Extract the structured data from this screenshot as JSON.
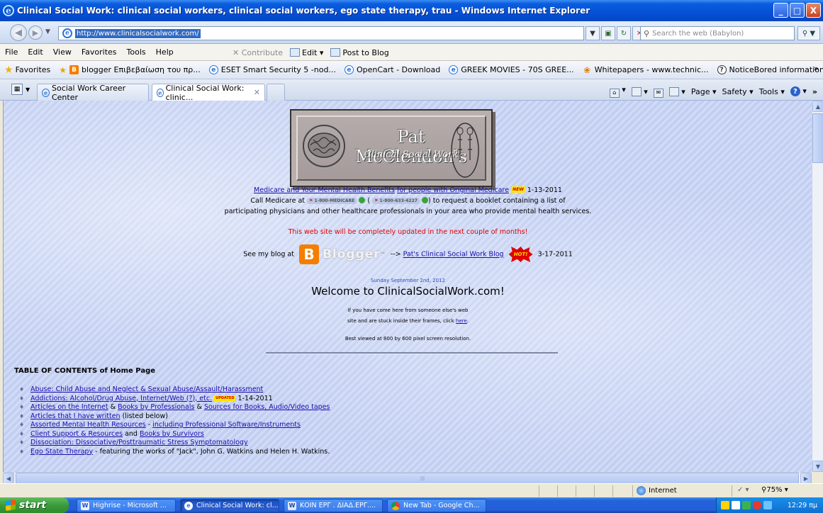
{
  "window": {
    "title": "Clinical Social Work: clinical social workers, clinical social workers, ego state therapy, trau - Windows Internet Explorer",
    "minimize": "_",
    "maximize": "□",
    "close": "X"
  },
  "address_bar": {
    "url": "http://www.clinicalsocialwork.com/",
    "search_placeholder": "Search the web (Babylon)"
  },
  "menu": {
    "items": [
      "File",
      "Edit",
      "View",
      "Favorites",
      "Tools",
      "Help"
    ],
    "contribute": "Contribute",
    "edit": "Edit",
    "post_to_blog": "Post to Blog"
  },
  "favorites_bar": {
    "label": "Favorites",
    "links": [
      {
        "label": "blogger Επιβεβαίωση του πρ...",
        "icon": "blogger-icon"
      },
      {
        "label": "ESET Smart Security 5 -nod...",
        "icon": "ie-page-icon"
      },
      {
        "label": "OpenCart - Download",
        "icon": "ie-page-icon"
      },
      {
        "label": "GREEK MOVIES - 70S GREE...",
        "icon": "ie-page-icon"
      },
      {
        "label": "Whitepapers - www.technic...",
        "icon": "whitepaper-icon"
      },
      {
        "label": "NoticeBored information sec...",
        "icon": "noticebored-icon"
      }
    ],
    "more": "»"
  },
  "tabs": {
    "items": [
      {
        "label": "Social Work Career Center"
      },
      {
        "label": "Clinical Social Work: clinic...",
        "active": true
      }
    ],
    "command_bar": {
      "page": "Page",
      "safety": "Safety",
      "tools": "Tools"
    },
    "more": "»"
  },
  "page": {
    "logo_title": "Pat McClendon's",
    "logo_subtitle": "Clinical Social Work",
    "medicare_link": "Medicare and Your Mental Health Benefits",
    "medicare_link2": "for people with Original Medicare",
    "new_badge": "NEW",
    "medicare_date": "1-13-2011",
    "call_prefix": "Call Medicare at",
    "phone1": "1-800-MEDICARE",
    "phone2": "1-800-633-4227",
    "call_suffix": "to request a booklet containing a list of",
    "call_line2": "participating physicians and other healthcare professionals in your area who provide mental health services.",
    "update_notice": "This web site will be completely updated in the next couple of months!",
    "blog_prefix": "See my blog at",
    "blogger_word": "Blogger",
    "blog_arrow": "-->",
    "blog_link": "Pat's Clinical Social Work Blog",
    "hot_badge": "HOT!",
    "blog_date": "3-17-2011",
    "current_date": "Sunday September 2nd, 2012",
    "welcome": "Welcome to ClinicalSocialWork.com!",
    "frames_line1": "If you have come here from someone else's web",
    "frames_line2": "site and are stuck inside their frames, click",
    "frames_link": "here",
    "best_viewed": "Best viewed at 800 by 600 pixel screen resolution.",
    "toc_heading": "TABLE OF CONTENTS of Home Page",
    "updated_badge": "UPDATED",
    "toc": [
      {
        "link": "Abuse: Child Abuse and Neglect & Sexual Abuse/Assault/Harassment"
      },
      {
        "link": "Addictions: Alcohol/Drug Abuse, Internet/Web (?), etc.",
        "date": "1-14-2011"
      },
      {
        "link": "Articles on the Internet",
        "mid1": "&",
        "link2": "Books by Professionals",
        "mid2": "&",
        "link3": "Sources for Books, Audio/Video tapes"
      },
      {
        "link": "Articles that I have written",
        "tail": "(listed below)"
      },
      {
        "link": "Assorted Mental Health Resources",
        "mid1": "-",
        "link2": "including Professional Software/Instruments"
      },
      {
        "link": "Client Support & Resources",
        "mid1": "and",
        "link2": "Books by Survivors"
      },
      {
        "link": "Dissociation: Dissociative/Posttraumatic Stress Symptomatology"
      },
      {
        "link": "Ego State Therapy",
        "tail": "- featuring the works of \"Jack\", John G. Watkins and Helen H. Watkins."
      }
    ]
  },
  "status_bar": {
    "zone": "Internet",
    "zoom": "75%"
  },
  "taskbar": {
    "start": "start",
    "tasks": [
      {
        "label": "Highrise - Microsoft ...",
        "icon": "word-icon"
      },
      {
        "label": "Clinical Social Work: cl...",
        "icon": "ie-icon",
        "active": true
      },
      {
        "label": "ΚΟΙΝ ΕΡΓ . ΔΙΑΔ.ΕΡΓ....",
        "icon": "document-icon"
      },
      {
        "label": "New Tab - Google Ch...",
        "icon": "chrome-icon"
      }
    ],
    "clock": "12:29 πμ"
  }
}
